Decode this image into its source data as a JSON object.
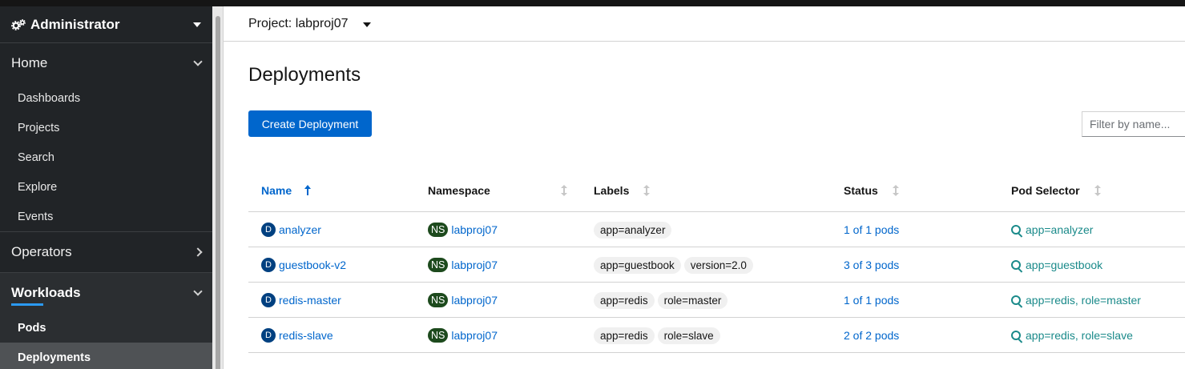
{
  "sidebar": {
    "perspective": "Administrator",
    "sections": {
      "home": {
        "title": "Home",
        "items": [
          "Dashboards",
          "Projects",
          "Search",
          "Explore",
          "Events"
        ]
      },
      "operators": {
        "title": "Operators"
      },
      "workloads": {
        "title": "Workloads",
        "items": [
          "Pods",
          "Deployments"
        ],
        "active": "Deployments"
      }
    }
  },
  "header": {
    "project_label": "Project: labproj07"
  },
  "main": {
    "title": "Deployments",
    "create_button": "Create Deployment",
    "filter_placeholder": "Filter by name..."
  },
  "table": {
    "columns": [
      "Name",
      "Namespace",
      "Labels",
      "Status",
      "Pod Selector"
    ],
    "sorted_column": "Name",
    "rows": [
      {
        "kind": "D",
        "name": "analyzer",
        "ns_badge": "NS",
        "namespace": "labproj07",
        "labels": [
          "app=analyzer"
        ],
        "status": "1 of 1 pods",
        "selector": "app=analyzer"
      },
      {
        "kind": "D",
        "name": "guestbook-v2",
        "ns_badge": "NS",
        "namespace": "labproj07",
        "labels": [
          "app=guestbook",
          "version=2.0"
        ],
        "status": "3 of 3 pods",
        "selector": "app=guestbook"
      },
      {
        "kind": "D",
        "name": "redis-master",
        "ns_badge": "NS",
        "namespace": "labproj07",
        "labels": [
          "app=redis",
          "role=master"
        ],
        "status": "1 of 1 pods",
        "selector": "app=redis, role=master"
      },
      {
        "kind": "D",
        "name": "redis-slave",
        "ns_badge": "NS",
        "namespace": "labproj07",
        "labels": [
          "app=redis",
          "role=slave"
        ],
        "status": "2 of 2 pods",
        "selector": "app=redis, role=slave"
      }
    ]
  },
  "colors": {
    "accent": "#0066cc",
    "sidebar_bg": "#212427",
    "ns_badge": "#1d4a1d",
    "resource_badge": "#004080",
    "selector": "#1a8a8a"
  }
}
